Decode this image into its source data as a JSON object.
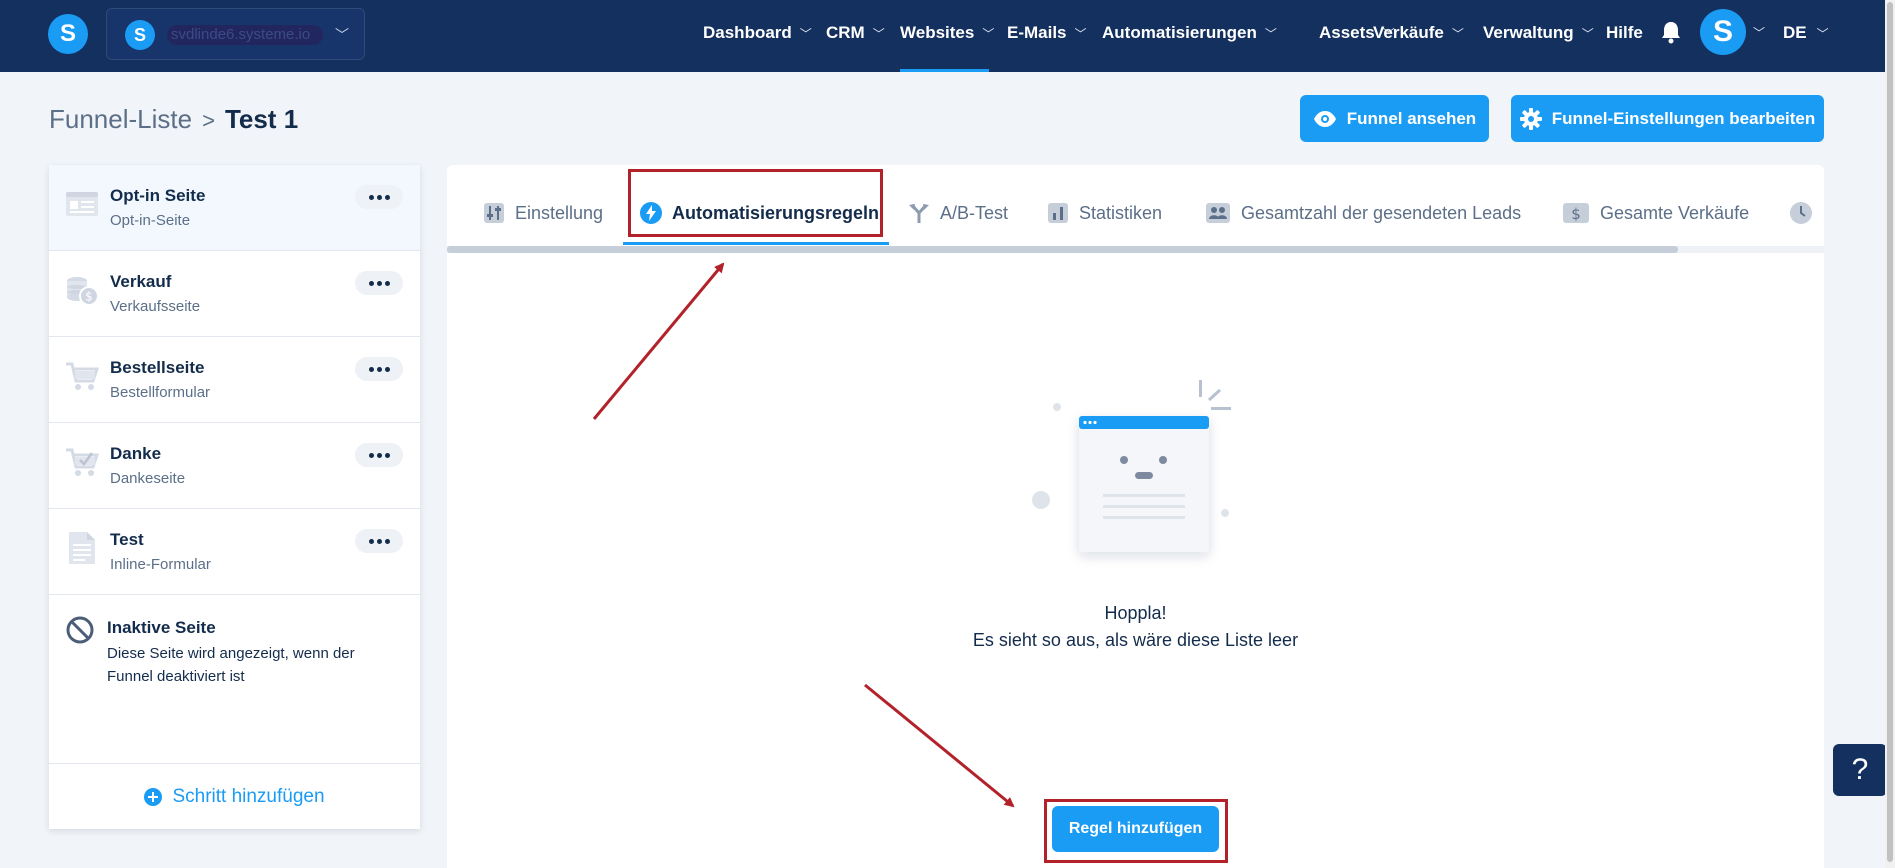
{
  "topbar": {
    "logo_letter": "S",
    "workspace": {
      "avatar_letter": "S",
      "name": "svdlinde6.systeme.io"
    },
    "nav": [
      {
        "label": "Dashboard"
      },
      {
        "label": "CRM"
      },
      {
        "label": "Websites",
        "active": true
      },
      {
        "label": "E-Mails"
      },
      {
        "label": "Automatisierungen"
      },
      {
        "label": "Assets"
      },
      {
        "label": "Verkäufe"
      },
      {
        "label": "Verwaltung"
      }
    ],
    "help_label": "Hilfe",
    "user_letter": "S",
    "language": "DE"
  },
  "breadcrumb": {
    "parent": "Funnel-Liste",
    "separator": ">",
    "current": "Test 1"
  },
  "actions": {
    "view_funnel": "Funnel ansehen",
    "edit_settings": "Funnel-Einstellungen bearbeiten"
  },
  "sidebar": {
    "steps": [
      {
        "name": "Opt-in Seite",
        "type": "Opt-in-Seite",
        "icon": "optin-page-icon",
        "active": true
      },
      {
        "name": "Verkauf",
        "type": "Verkaufsseite",
        "icon": "sales-coins-icon"
      },
      {
        "name": "Bestellseite",
        "type": "Bestellformular",
        "icon": "order-cart-icon"
      },
      {
        "name": "Danke",
        "type": "Dankeseite",
        "icon": "thanks-cart-check-icon"
      },
      {
        "name": "Test",
        "type": "Inline-Formular",
        "icon": "inline-form-document-icon"
      }
    ],
    "inactive": {
      "title": "Inaktive Seite",
      "description": "Diese Seite wird angezeigt, wenn der Funnel deaktiviert ist"
    },
    "add_step": "Schritt hinzufügen"
  },
  "tabs": [
    {
      "label": "Einstellung",
      "icon": "sliders-icon"
    },
    {
      "label": "Automatisierungsregeln",
      "icon": "lightning-icon",
      "active": true
    },
    {
      "label": "A/B-Test",
      "icon": "split-icon"
    },
    {
      "label": "Statistiken",
      "icon": "bar-chart-icon"
    },
    {
      "label": "Gesamtzahl der gesendeten Leads",
      "icon": "users-icon"
    },
    {
      "label": "Gesamte Verkäufe",
      "icon": "dollar-icon"
    }
  ],
  "empty_state": {
    "title": "Hoppla!",
    "subtitle": "Es sieht so aus, als wäre diese Liste leer"
  },
  "add_rule": "Regel hinzufügen",
  "help_button": "?",
  "colors": {
    "navy": "#14305e",
    "accent": "#1a9bf4",
    "annotation": "#b3222a"
  }
}
